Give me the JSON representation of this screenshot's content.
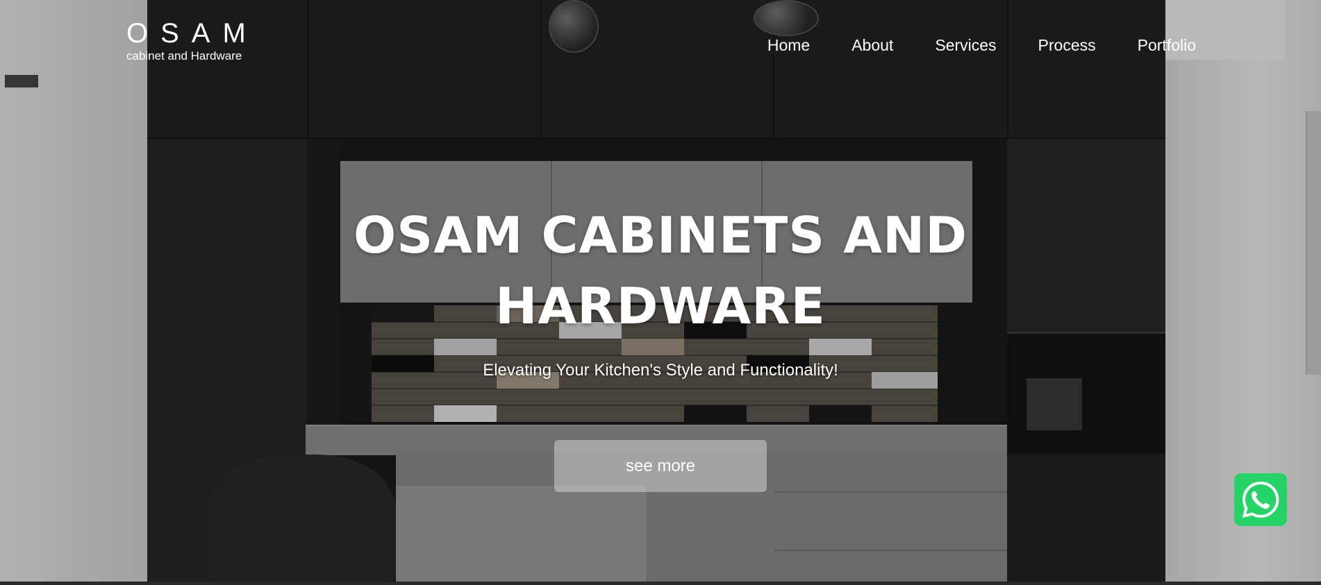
{
  "header": {
    "logo_mark": "OSAM",
    "logo_subtitle": "cabinet and Hardware",
    "nav": [
      {
        "label": "Home"
      },
      {
        "label": "About"
      },
      {
        "label": "Services"
      },
      {
        "label": "Process"
      },
      {
        "label": "Portfolio"
      }
    ]
  },
  "hero": {
    "title_line1": "OSAM CABINETS AND",
    "title_line2": "HARDWARE",
    "subtitle": "Elevating Your Kitchen's Style and Functionality!",
    "cta_label": "see more"
  },
  "floating": {
    "whatsapp_icon": "whatsapp-icon",
    "whatsapp_color": "#25d366"
  },
  "colors": {
    "text": "#ffffff",
    "button_bg": "rgba(210,210,210,0.55)"
  }
}
